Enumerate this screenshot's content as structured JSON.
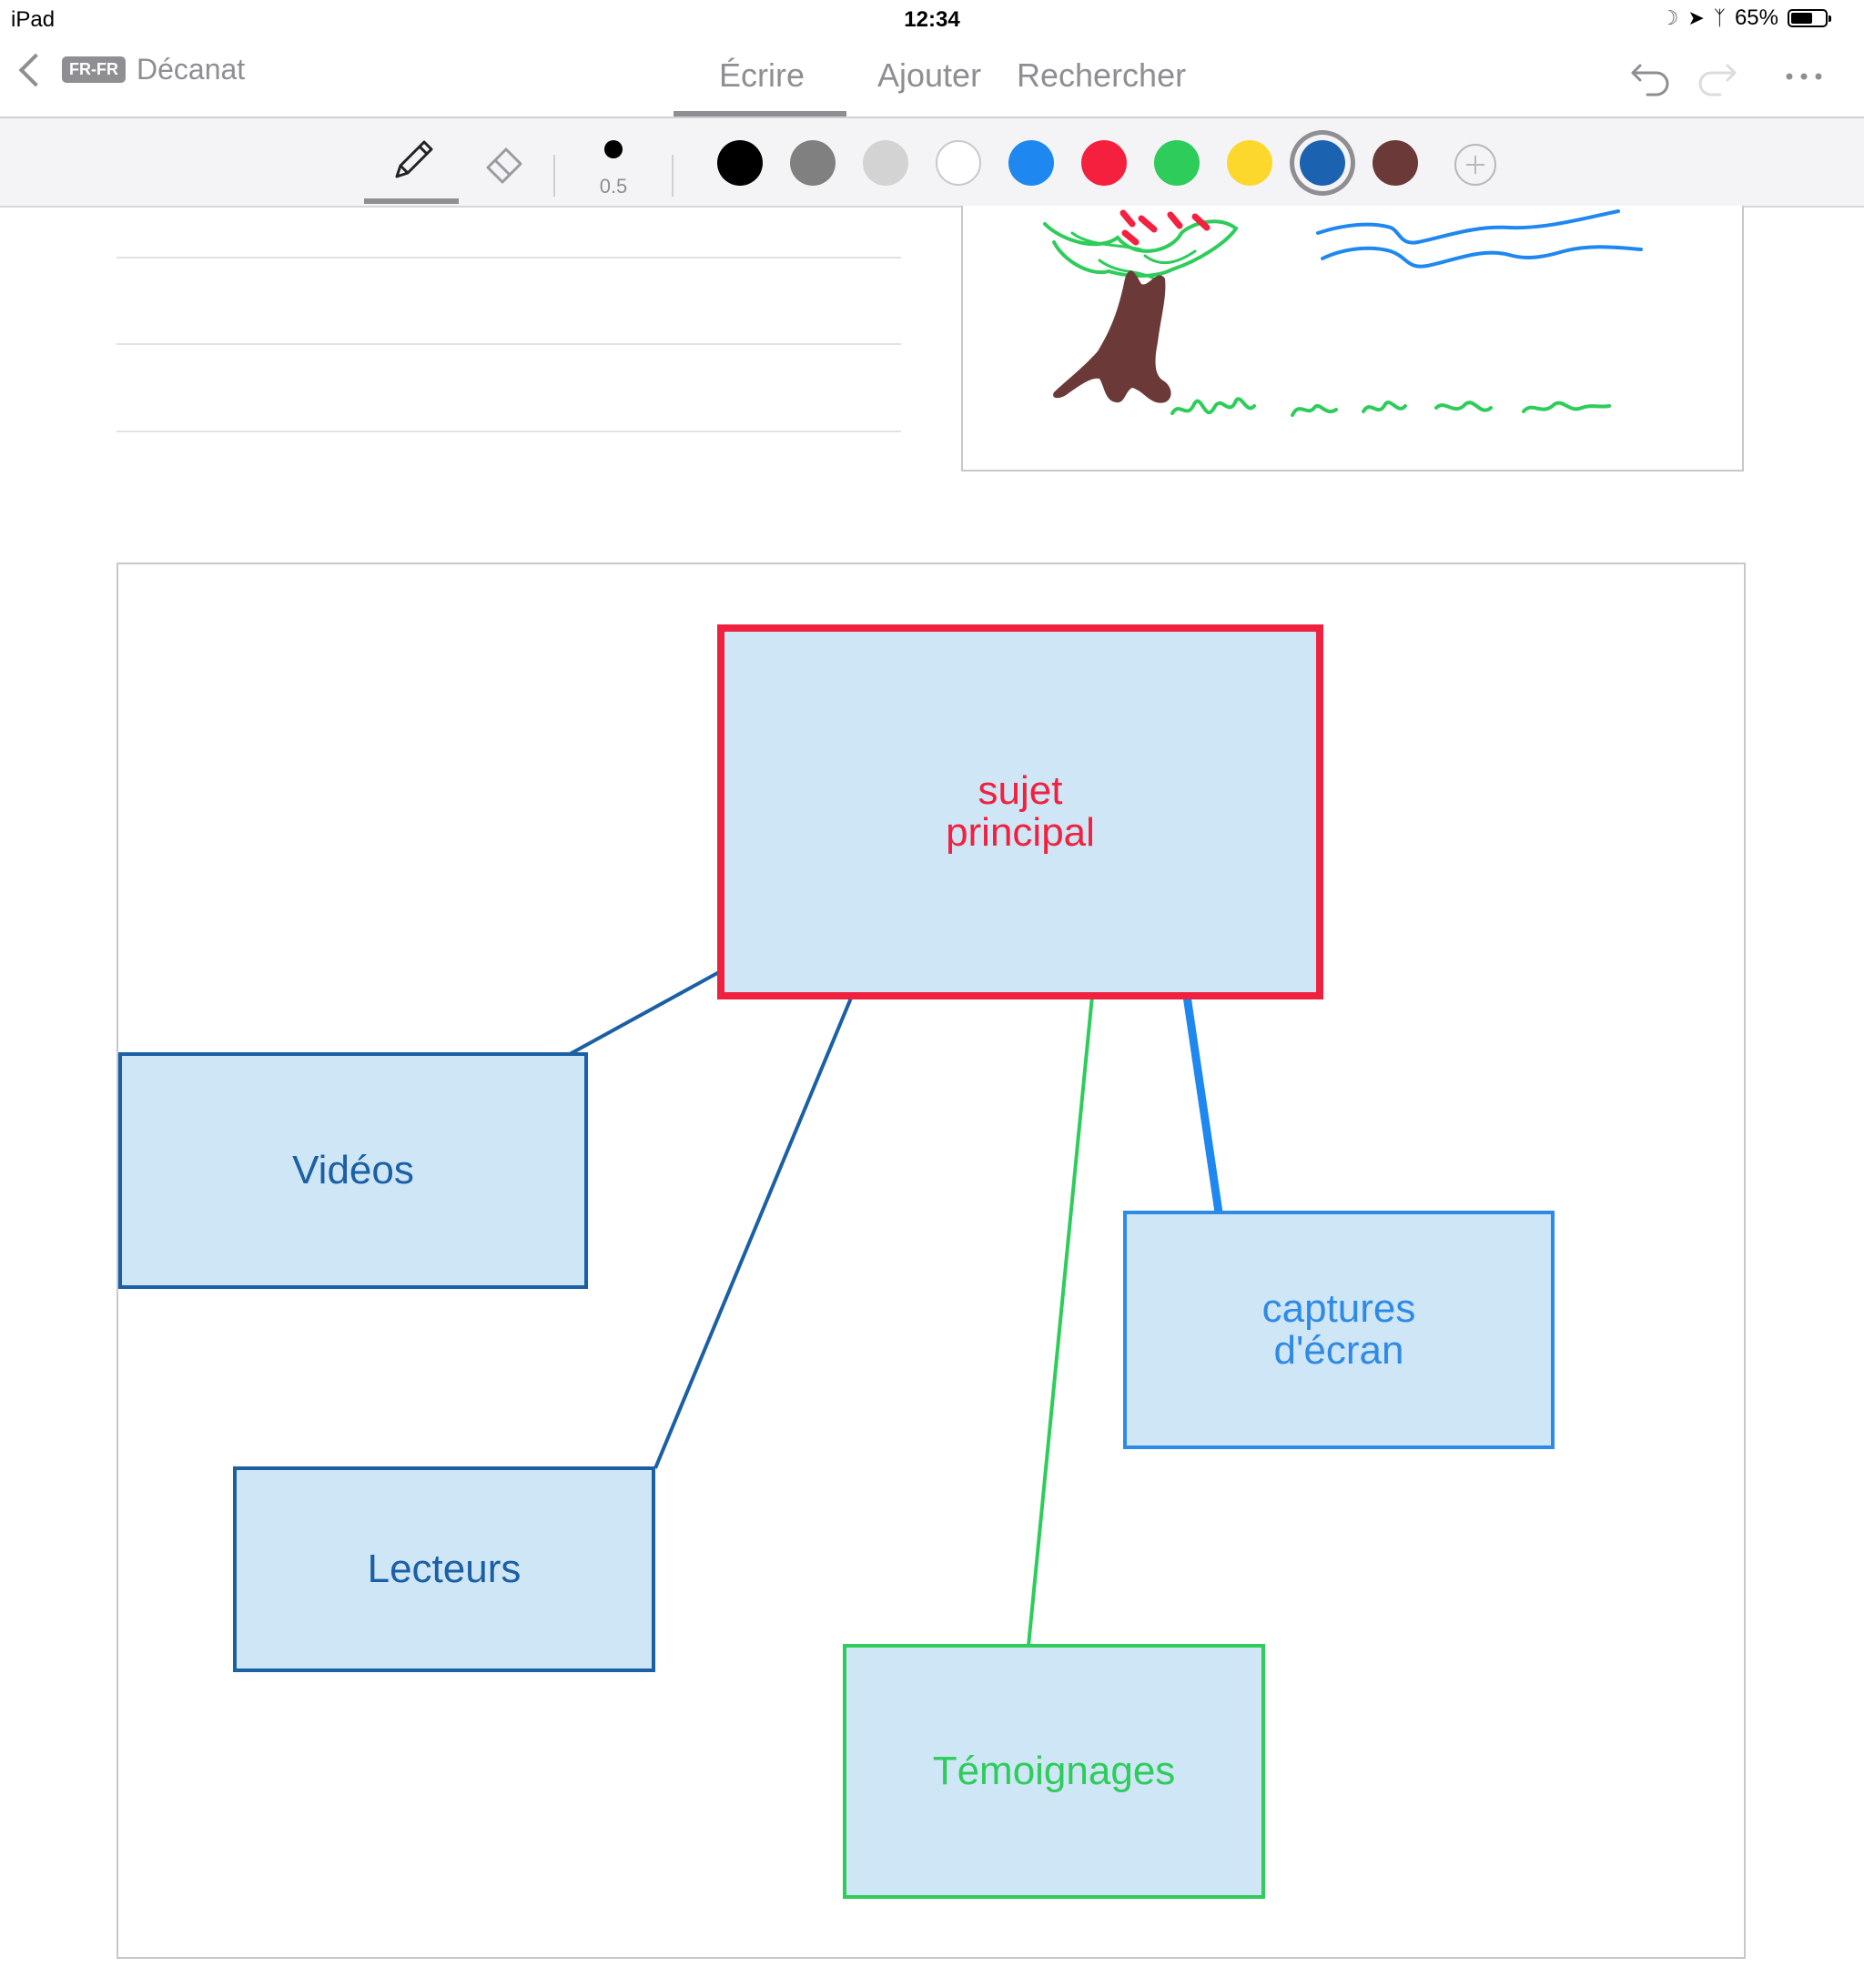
{
  "status_bar": {
    "device": "iPad",
    "time": "12:34",
    "battery": "65%",
    "battery_level": 0.65
  },
  "nav": {
    "lang_badge": "FR-FR",
    "back_label": "Décanat",
    "tabs": [
      {
        "label": "Écrire",
        "active": true
      },
      {
        "label": "Ajouter",
        "active": false
      },
      {
        "label": "Rechercher",
        "active": false
      }
    ],
    "icons": [
      "undo-icon",
      "redo-icon",
      "more-icon"
    ]
  },
  "toolbar": {
    "tools": [
      "pencil-icon",
      "eraser-icon"
    ],
    "stroke_size": "0.5",
    "colors": [
      "#000000",
      "#808080",
      "#d3d3d3",
      "#ffffff",
      "#1e88f0",
      "#f5203e",
      "#2ecc5a",
      "#fcd82c",
      "#1b63b0",
      "#6b3a38"
    ],
    "selected_color": "#1b63b0",
    "add_color_icon": "plus-icon"
  },
  "mindmap": {
    "main": {
      "label_line1": "sujet",
      "label_line2": "principal",
      "color": "#f0213f"
    },
    "nodes": [
      {
        "key": "videos",
        "label": "Vidéos",
        "color": "#1b5fa5"
      },
      {
        "key": "lecteurs",
        "label": "Lecteurs",
        "color": "#1b5fa5"
      },
      {
        "key": "temoignages",
        "label": "Témoignages",
        "color": "#2ecc5a"
      },
      {
        "key": "captures",
        "label_line1": "captures",
        "label_line2": "d'écran",
        "color": "#2f8ae6"
      }
    ],
    "node_fill": "#cfe6f6"
  }
}
